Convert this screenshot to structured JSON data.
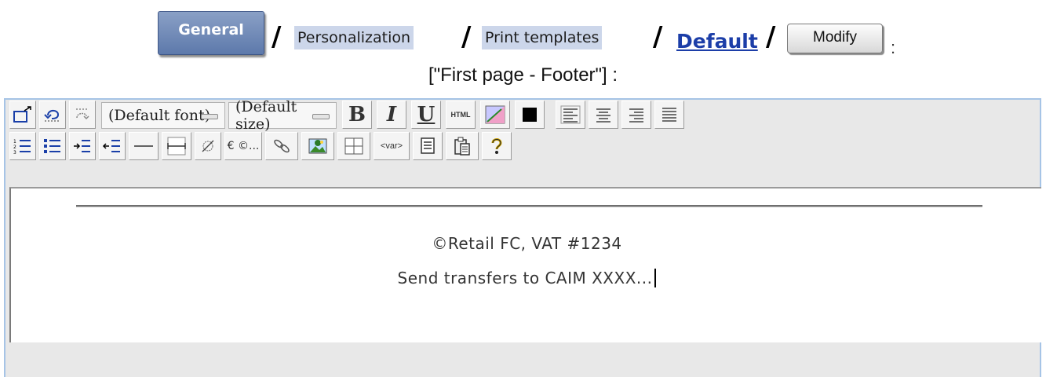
{
  "breadcrumb": {
    "general": "General",
    "separator": "/",
    "personalization": "Personalization",
    "print_templates": "Print templates",
    "current": "Default",
    "modify": "Modify",
    "colon": ":"
  },
  "subtitle": "[\"First page - Footer\"] :",
  "toolbar": {
    "font_select": "(Default font)",
    "size_select": "(Default size)",
    "bold": "B",
    "italic": "I",
    "underline": "U",
    "html": "HTML",
    "special_chars": "€ ©...",
    "var": "<var>"
  },
  "editor": {
    "line1": "©Retail FC, VAT #1234",
    "line2": "Send transfers to CAIM XXXX..."
  },
  "colors": {
    "accent": "#5d79ab",
    "link": "#1c3ea8",
    "crumb_bg": "#ccd6ea",
    "frame_border": "#a6c4e6"
  }
}
